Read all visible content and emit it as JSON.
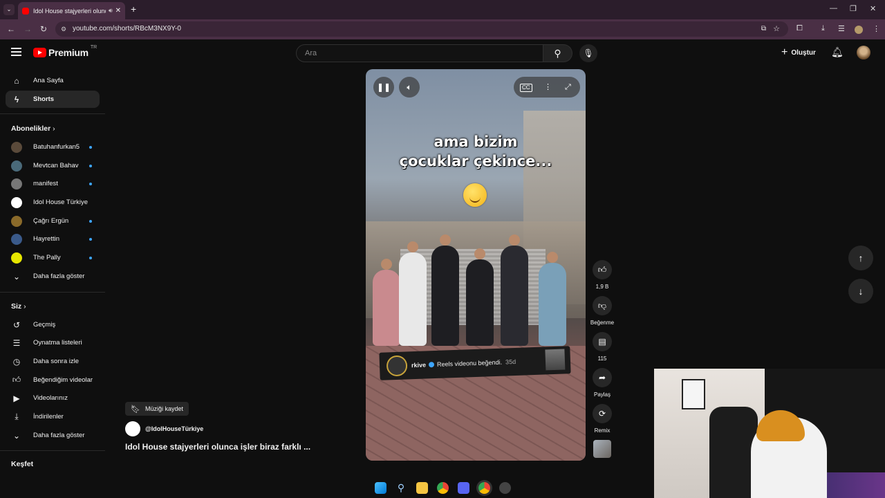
{
  "browser": {
    "tab_title": "Idol House stajyerleri olunca işler biraz farklı...",
    "url": "youtube.com/shorts/RBcM3NX9Y-0"
  },
  "header": {
    "logo_text": "Premium",
    "logo_country": "TR",
    "search_placeholder": "Ara",
    "create_label": "Oluştur"
  },
  "sidebar": {
    "main": [
      {
        "label": "Ana Sayfa",
        "icon": "home-icon"
      },
      {
        "label": "Shorts",
        "icon": "shorts-icon",
        "active": true
      }
    ],
    "subs_header": "Abonelikler",
    "subscriptions": [
      {
        "label": "Batuhanfurkan5",
        "dot": true,
        "color": "#5a4a3a"
      },
      {
        "label": "Mevtcan Bahav",
        "dot": true,
        "color": "#4a6a7a"
      },
      {
        "label": "manifest",
        "dot": true,
        "color": "#777777"
      },
      {
        "label": "Idol House Türkiye",
        "dot": false,
        "color": "#ffffff"
      },
      {
        "label": "Çağrı Ergün",
        "dot": true,
        "color": "#8a6a2a"
      },
      {
        "label": "Hayrettin",
        "dot": true,
        "color": "#3a5a8a"
      },
      {
        "label": "The Pally",
        "dot": true,
        "color": "#e6e600"
      }
    ],
    "subs_more": "Daha fazla göster",
    "you_header": "Siz",
    "you_items": [
      {
        "label": "Geçmiş",
        "icon": "history-icon"
      },
      {
        "label": "Oynatma listeleri",
        "icon": "playlist-icon"
      },
      {
        "label": "Daha sonra izle",
        "icon": "clock-icon"
      },
      {
        "label": "Beğendiğim videolar",
        "icon": "thumbs-up-icon"
      },
      {
        "label": "Videolarınız",
        "icon": "video-icon"
      },
      {
        "label": "İndirilenler",
        "icon": "download-icon"
      }
    ],
    "you_more": "Daha fazla göster",
    "explore_header": "Keşfet"
  },
  "video": {
    "caption_line1": "ama bizim",
    "caption_line2": "çocuklar çekince...",
    "notif_user": "rkive",
    "notif_text": "Reels videonu beğendi.",
    "notif_time": "35d"
  },
  "actions": {
    "likes": "1,9 B",
    "dislike_label": "Beğenme",
    "comments": "115",
    "share_label": "Paylaş",
    "remix_label": "Remix"
  },
  "info": {
    "save_music": "Müziği kaydet",
    "channel": "@IdolHouseTürkiye",
    "title": "Idol House stajyerleri olunca işler biraz farklı ..."
  },
  "colors": {
    "accent_red": "#ff0000",
    "live_dot": "#3ea6ff"
  }
}
